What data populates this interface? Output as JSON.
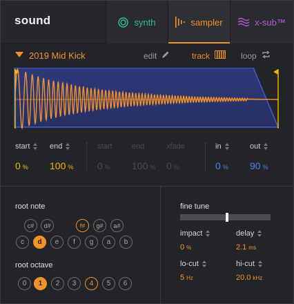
{
  "header": {
    "title": "sound",
    "tabs": [
      {
        "label": "synth",
        "icon": "synth-circle-icon",
        "color": "#36c08a"
      },
      {
        "label": "sampler",
        "icon": "sampler-bars-icon",
        "color": "#f4922a",
        "active": true
      },
      {
        "label": "x-sub™",
        "icon": "xsub-waves-icon",
        "color": "#b45ce6"
      }
    ]
  },
  "sample": {
    "name": "2019 Mid Kick",
    "modes": {
      "edit": "edit",
      "track": "track",
      "loop": "loop"
    },
    "active_mode": "track"
  },
  "markers": {
    "start": {
      "label": "start",
      "value": "0",
      "unit": "%"
    },
    "end": {
      "label": "end",
      "value": "100",
      "unit": "%"
    },
    "loop_start": {
      "label": "start",
      "value": "0",
      "unit": "%"
    },
    "loop_end": {
      "label": "end",
      "value": "100",
      "unit": "%"
    },
    "xfade": {
      "label": "xfade",
      "value": "0",
      "unit": "%"
    },
    "in": {
      "label": "in",
      "value": "0",
      "unit": "%"
    },
    "out": {
      "label": "out",
      "value": "90",
      "unit": "%"
    }
  },
  "root_note": {
    "label": "root note",
    "sharps": [
      "c#",
      "d#",
      "f#",
      "g#",
      "a#"
    ],
    "naturals": [
      "c",
      "d",
      "e",
      "f",
      "g",
      "a",
      "b"
    ],
    "selected": "d",
    "highlighted": [
      "f#",
      "g#",
      "a#"
    ]
  },
  "root_octave": {
    "label": "root octave",
    "values": [
      "0",
      "1",
      "2",
      "3",
      "4",
      "5",
      "6"
    ],
    "selected": "1",
    "highlighted": "4"
  },
  "fine_tune": {
    "label": "fine tune",
    "value": 0.52
  },
  "params": {
    "impact": {
      "label": "impact",
      "value": "0",
      "unit": "%"
    },
    "delay": {
      "label": "delay",
      "value": "2.1",
      "unit": "ms"
    },
    "locut": {
      "label": "lo-cut",
      "value": "5",
      "unit": "Hz"
    },
    "hicut": {
      "label": "hi-cut",
      "value": "20.0",
      "unit": "kHz"
    }
  },
  "colors": {
    "accent": "#f4922a",
    "value_yellow": "#f4b400",
    "value_blue": "#4c7cf0",
    "synth": "#36c08a",
    "xsub": "#b45ce6"
  }
}
